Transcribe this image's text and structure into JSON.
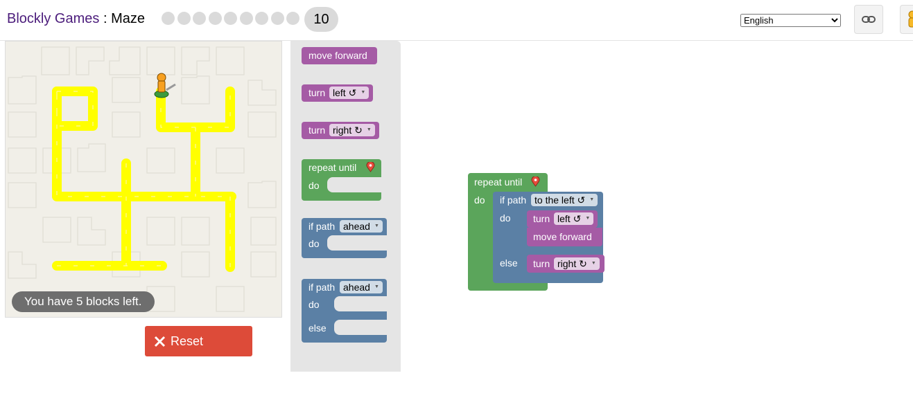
{
  "header": {
    "brand": "Blockly Games",
    "separator": ":",
    "game": "Maze",
    "levels": [
      1,
      2,
      3,
      4,
      5,
      6,
      7,
      8,
      9
    ],
    "current_level": "10",
    "language": "English",
    "language_options": [
      "English"
    ],
    "link_icon": "link-icon",
    "character_icon": "pegman-icon"
  },
  "maze": {
    "status": "You have 5 blocks left.",
    "reset_label": "Reset",
    "colors": {
      "path": "#ffff00",
      "background": "#f1efe8",
      "reset": "#dd4b39"
    }
  },
  "toolbox": {
    "move_forward": "move forward",
    "turn_left": {
      "label": "turn",
      "value": "left ↺"
    },
    "turn_right": {
      "label": "turn",
      "value": "right ↻"
    },
    "repeat_until": {
      "label": "repeat until",
      "do": "do"
    },
    "if_path": {
      "label": "if path",
      "value": "ahead",
      "do": "do"
    },
    "if_path_else": {
      "label": "if path",
      "value": "ahead",
      "do": "do",
      "else": "else"
    }
  },
  "workspace": {
    "repeat_label": "repeat until",
    "repeat_do": "do",
    "if_label": "if path",
    "if_value": "to the left ↺",
    "if_do": "do",
    "turn_left_label": "turn",
    "turn_left_value": "left ↺",
    "move_forward": "move forward",
    "else_label": "else",
    "turn_right_label": "turn",
    "turn_right_value": "right ↻",
    "colors": {
      "motion": "#a55ba5",
      "loop": "#5ba55b",
      "logic": "#5b80a5"
    }
  }
}
